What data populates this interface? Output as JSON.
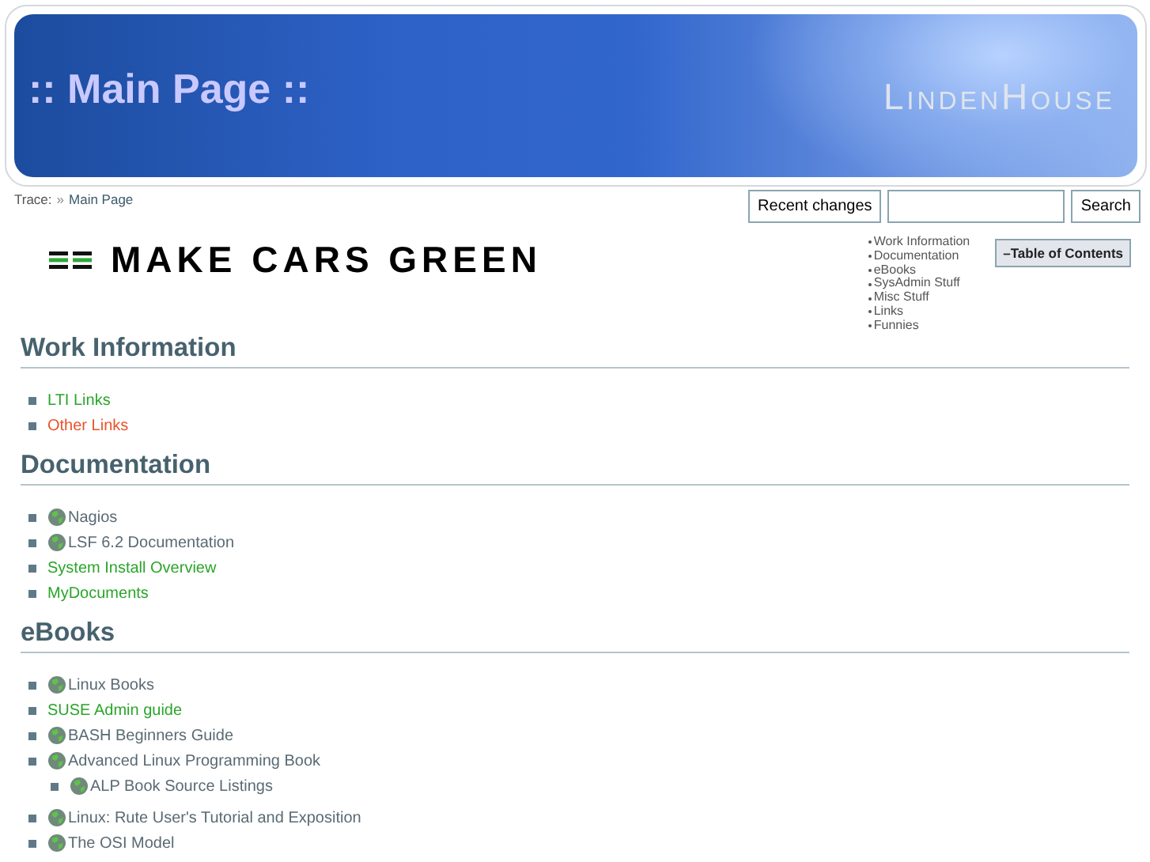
{
  "header": {
    "title": ":: Main Page ::",
    "site_name": "LindenHouse"
  },
  "trace": {
    "label": "Trace:",
    "separator": "»",
    "link": "Main Page"
  },
  "toolbar": {
    "recent_changes": "Recent changes",
    "search_button": "Search"
  },
  "banner": {
    "text": "MAKE CARS GREEN"
  },
  "toc": {
    "items": [
      "Work Information",
      "Documentation",
      "eBooks",
      "SysAdmin Stuff",
      "Misc Stuff",
      "Links",
      "Funnies"
    ],
    "toggle": "–Table of Contents"
  },
  "sections": [
    {
      "heading": "Work Information",
      "items": [
        {
          "label": "LTI Links",
          "kind": "internal"
        },
        {
          "label": "Other Links",
          "kind": "missing"
        }
      ]
    },
    {
      "heading": "Documentation",
      "items": [
        {
          "label": "Nagios",
          "kind": "external"
        },
        {
          "label": "LSF 6.2 Documentation",
          "kind": "external"
        },
        {
          "label": "System Install Overview",
          "kind": "internal"
        },
        {
          "label": "MyDocuments",
          "kind": "internal"
        }
      ]
    },
    {
      "heading": "eBooks",
      "items": [
        {
          "label": "Linux Books",
          "kind": "external"
        },
        {
          "label": "SUSE Admin guide",
          "kind": "internal"
        },
        {
          "label": "BASH Beginners Guide",
          "kind": "external"
        },
        {
          "label": "Advanced Linux Programming Book",
          "kind": "external",
          "children": [
            {
              "label": "ALP Book Source Listings",
              "kind": "external"
            }
          ]
        },
        {
          "label": "Linux: Rute User's Tutorial and Exposition",
          "kind": "external"
        },
        {
          "label": "The OSI Model",
          "kind": "external"
        }
      ]
    }
  ]
}
